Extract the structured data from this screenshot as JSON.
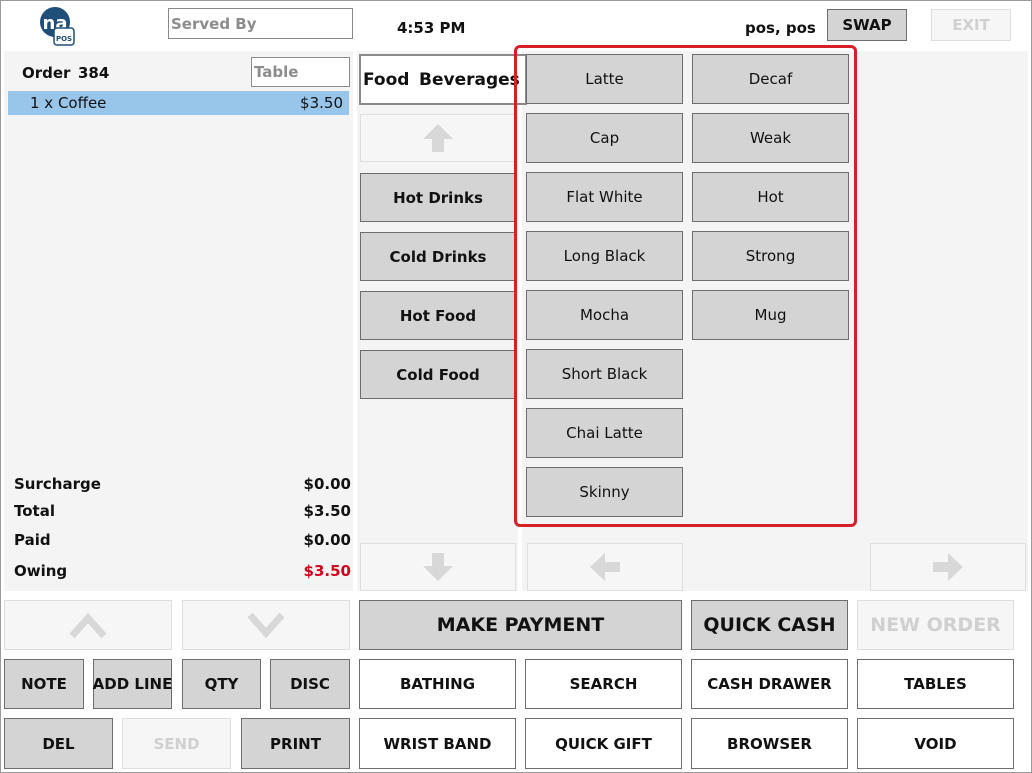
{
  "header": {
    "served_by_placeholder": "Served By",
    "time": "4:53 PM",
    "user": "pos, pos",
    "swap_label": "SWAP",
    "exit_label": "EXIT"
  },
  "order": {
    "label": "Order",
    "number": "384",
    "table_placeholder": "Table",
    "lines": [
      {
        "desc": "1 x Coffee",
        "price": "$3.50"
      }
    ],
    "totals": {
      "surcharge_label": "Surcharge",
      "surcharge": "$0.00",
      "total_label": "Total",
      "total": "$3.50",
      "paid_label": "Paid",
      "paid": "$0.00",
      "owing_label": "Owing",
      "owing": "$3.50"
    }
  },
  "categories": {
    "tabs": [
      "Food",
      "Beverages"
    ],
    "items": [
      "Hot Drinks",
      "Cold Drinks",
      "Hot Food",
      "Cold Food"
    ]
  },
  "products": {
    "col1": [
      "Latte",
      "Cap",
      "Flat White",
      "Long Black",
      "Mocha",
      "Short Black",
      "Chai Latte",
      "Skinny"
    ],
    "col2": [
      "Decaf",
      "Weak",
      "Hot",
      "Strong",
      "Mug"
    ]
  },
  "actions": {
    "note": "NOTE",
    "add_line": "ADD LINE",
    "qty": "QTY",
    "disc": "DISC",
    "del": "DEL",
    "send": "SEND",
    "print": "PRINT",
    "make_payment": "MAKE PAYMENT",
    "quick_cash": "QUICK CASH",
    "new_order": "NEW ORDER",
    "bathing": "BATHING",
    "search": "SEARCH",
    "cash_drawer": "CASH DRAWER",
    "tables": "TABLES",
    "wrist_band": "WRIST BAND",
    "quick_gift": "QUICK GIFT",
    "browser": "BROWSER",
    "void": "VOID"
  },
  "colors": {
    "selected_line": "#98c6ea",
    "owing": "#d0021b",
    "highlight": "#d61f26",
    "button": "#d4d4d4"
  },
  "icons": {
    "logo": "pos-logo-icon",
    "up": "arrow-up-icon",
    "down": "arrow-down-icon",
    "left": "arrow-left-icon",
    "right": "arrow-right-icon"
  }
}
